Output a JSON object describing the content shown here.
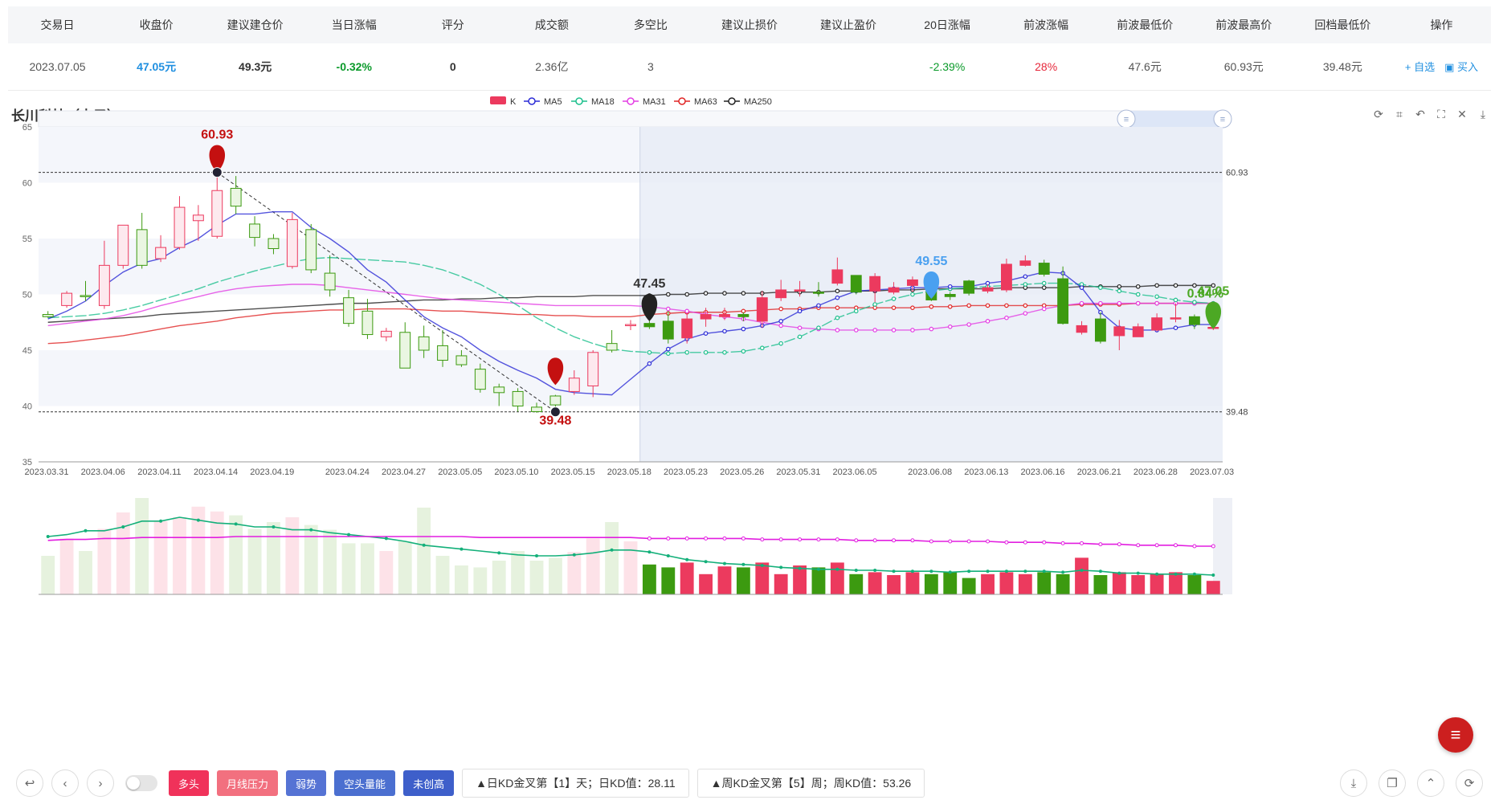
{
  "table": {
    "headers": [
      "交易日",
      "收盘价",
      "建议建仓价",
      "当日涨幅",
      "评分",
      "成交额",
      "多空比",
      "建议止损价",
      "建议止盈价",
      "20日涨幅",
      "前波涨幅",
      "前波最低价",
      "前波最高价",
      "回档最低价",
      "操作"
    ],
    "row": {
      "date": "2023.07.05",
      "close": "47.05元",
      "entry": "49.3元",
      "change": "-0.32%",
      "score": "0",
      "turnover": "2.36亿",
      "ratio": "3",
      "stop_loss": "",
      "take_profit": "",
      "chg20": "-2.39%",
      "prev_wave": "28%",
      "prev_low": "47.6元",
      "prev_high": "60.93元",
      "pullback_low": "39.48元",
      "op_watch": "+ 自选",
      "op_buy": "▣ 买入"
    }
  },
  "chart_title": "长川科技（电子）",
  "legend": [
    "K",
    "MA5",
    "MA18",
    "MA31",
    "MA63",
    "MA250"
  ],
  "colors": {
    "up": "#ec3a5e",
    "down": "#3c9a10",
    "ma5": "#2b2bd6",
    "ma18": "#1cbf8c",
    "ma31": "#e43ee4",
    "ma63": "#e02424",
    "ma250": "#222222",
    "pin_high": "#c41010",
    "pin_cur": "#4aa0f0",
    "pin_last": "#4ca824"
  },
  "chart_data": {
    "type": "candlestick",
    "ylim": [
      35,
      65
    ],
    "yticks": [
      "65",
      "60",
      "55",
      "50",
      "45",
      "40",
      "35"
    ],
    "xticks": [
      "2023.03.31",
      "2023.04.06",
      "2023.04.11",
      "2023.04.14",
      "2023.04.19",
      "2023.04.24",
      "2023.04.27",
      "2023.05.05",
      "2023.05.10",
      "2023.05.15",
      "2023.05.18",
      "2023.05.23",
      "2023.05.26",
      "2023.05.31",
      "2023.06.05",
      "2023.06.08",
      "2023.06.13",
      "2023.06.16",
      "2023.06.21",
      "2023.06.28",
      "2023.07.03"
    ],
    "candles": [
      [
        48.2,
        48.0,
        48.5,
        47.9
      ],
      [
        49.0,
        50.1,
        50.3,
        48.8
      ],
      [
        49.9,
        49.8,
        51.2,
        49.4
      ],
      [
        49.0,
        52.6,
        54.8,
        48.7
      ],
      [
        52.6,
        56.2,
        56.2,
        52.3
      ],
      [
        55.8,
        52.6,
        57.3,
        52.3
      ],
      [
        53.2,
        54.2,
        55.3,
        52.9
      ],
      [
        54.2,
        57.8,
        58.8,
        54.0
      ],
      [
        56.6,
        57.1,
        58.0,
        54.8
      ],
      [
        55.2,
        59.3,
        60.9,
        55.0
      ],
      [
        59.5,
        57.9,
        60.6,
        57.2
      ],
      [
        56.3,
        55.1,
        57.0,
        54.3
      ],
      [
        55.0,
        54.1,
        55.4,
        53.6
      ],
      [
        52.5,
        56.7,
        57.3,
        52.3
      ],
      [
        55.8,
        52.2,
        56.3,
        51.9
      ],
      [
        51.9,
        50.4,
        53.5,
        49.8
      ],
      [
        49.7,
        47.4,
        50.4,
        47.1
      ],
      [
        48.5,
        46.4,
        49.6,
        46.0
      ],
      [
        46.2,
        46.7,
        47.0,
        45.8
      ],
      [
        46.6,
        43.4,
        47.5,
        43.4
      ],
      [
        46.2,
        45.0,
        47.2,
        44.3
      ],
      [
        45.4,
        44.1,
        46.8,
        43.5
      ],
      [
        44.5,
        43.7,
        45.0,
        43.5
      ],
      [
        43.3,
        41.5,
        43.8,
        41.2
      ],
      [
        41.7,
        41.2,
        42.0,
        40.0
      ],
      [
        41.3,
        40.0,
        41.6,
        39.5
      ],
      [
        39.9,
        39.5,
        40.3,
        39.4
      ],
      [
        40.9,
        40.1,
        41.0,
        39.6
      ],
      [
        41.3,
        42.5,
        43.2,
        41.0
      ],
      [
        41.8,
        44.8,
        45.0,
        40.8
      ],
      [
        45.6,
        45.0,
        46.8,
        44.8
      ],
      [
        47.2,
        47.3,
        47.7,
        46.8
      ],
      [
        47.4,
        47.1,
        48.0,
        46.9
      ],
      [
        47.6,
        46.0,
        48.5,
        45.6
      ],
      [
        46.1,
        47.8,
        48.3,
        45.6
      ],
      [
        47.8,
        48.2,
        48.8,
        47.1
      ],
      [
        48.0,
        48.2,
        48.8,
        47.7
      ],
      [
        48.2,
        48.0,
        48.4,
        47.6
      ],
      [
        47.6,
        49.7,
        50.3,
        47.0
      ],
      [
        49.7,
        50.4,
        51.3,
        49.4
      ],
      [
        50.3,
        50.4,
        51.2,
        49.8
      ],
      [
        50.2,
        50.1,
        51.1,
        49.8
      ],
      [
        51.0,
        52.2,
        53.3,
        50.8
      ],
      [
        51.7,
        50.2,
        51.7,
        50.0
      ],
      [
        50.3,
        51.6,
        51.9,
        49.3
      ],
      [
        50.2,
        50.6,
        51.1,
        50.0
      ],
      [
        50.8,
        51.3,
        51.6,
        50.2
      ],
      [
        51.0,
        49.5,
        51.0,
        49.4
      ],
      [
        50.0,
        49.8,
        50.2,
        49.5
      ],
      [
        51.2,
        50.1,
        51.3,
        49.9
      ],
      [
        50.3,
        50.6,
        50.9,
        50.1
      ],
      [
        50.4,
        52.7,
        53.2,
        50.2
      ],
      [
        52.6,
        53.0,
        53.5,
        52.5
      ],
      [
        52.8,
        51.8,
        53.1,
        51.6
      ],
      [
        51.4,
        47.4,
        52.5,
        47.3
      ],
      [
        46.6,
        47.2,
        47.6,
        46.4
      ],
      [
        47.8,
        45.8,
        48.4,
        45.6
      ],
      [
        46.3,
        47.1,
        47.7,
        45.0
      ],
      [
        46.2,
        47.1,
        47.4,
        46.8
      ],
      [
        46.8,
        47.9,
        48.3,
        46.7
      ],
      [
        47.9,
        47.9,
        49.2,
        47.5
      ],
      [
        48.0,
        47.3,
        48.2,
        46.9
      ],
      [
        47.0,
        47.05,
        47.3,
        46.8
      ]
    ],
    "ma5": [
      47.8,
      48.5,
      49.4,
      50.8,
      52.0,
      52.8,
      53.2,
      54.2,
      55.0,
      56.2,
      57.2,
      57.2,
      57.4,
      57.4,
      56.0,
      55.0,
      53.8,
      52.2,
      51.1,
      49.5,
      48.0,
      47.0,
      46.2,
      45.0,
      44.0,
      43.2,
      42.5,
      41.5,
      41.2,
      41.1,
      41.0,
      42.4,
      43.8,
      45.1,
      46.0,
      46.5,
      46.7,
      46.9,
      47.2,
      47.6,
      48.5,
      49.0,
      49.7,
      50.3,
      50.4,
      50.5,
      50.6,
      50.6,
      50.7,
      50.7,
      51.0,
      51.2,
      51.6,
      52.0,
      51.9,
      50.6,
      48.4,
      47.0,
      46.8,
      46.8,
      47.0,
      47.3,
      47.3
    ],
    "ma18": [
      47.9,
      48.0,
      48.1,
      48.3,
      48.6,
      49.0,
      49.5,
      50.0,
      50.5,
      51.1,
      51.6,
      52.1,
      52.5,
      52.9,
      53.2,
      53.3,
      53.2,
      53.1,
      53.0,
      52.9,
      52.6,
      52.2,
      51.6,
      50.9,
      50.0,
      49.0,
      47.9,
      47.0,
      46.2,
      45.6,
      45.1,
      44.9,
      44.8,
      44.7,
      44.8,
      44.8,
      44.8,
      44.9,
      45.2,
      45.6,
      46.2,
      47.0,
      47.9,
      48.5,
      49.1,
      49.6,
      50.0,
      50.3,
      50.5,
      50.6,
      50.7,
      50.8,
      50.9,
      51.0,
      51.0,
      50.9,
      50.6,
      50.3,
      50.0,
      49.8,
      49.5,
      49.3,
      49.2
    ],
    "ma31": [
      47.2,
      47.4,
      47.6,
      47.8,
      48.1,
      48.5,
      49.0,
      49.4,
      49.8,
      50.2,
      50.5,
      50.7,
      50.8,
      50.9,
      50.9,
      50.8,
      50.6,
      50.4,
      50.2,
      50.0,
      49.8,
      49.6,
      49.5,
      49.4,
      49.3,
      49.2,
      49.1,
      49.0,
      49.0,
      49.0,
      49.0,
      49.0,
      48.9,
      48.7,
      48.5,
      48.2,
      48.0,
      47.8,
      47.5,
      47.2,
      47.0,
      46.9,
      46.8,
      46.8,
      46.8,
      46.8,
      46.8,
      46.9,
      47.1,
      47.3,
      47.6,
      47.9,
      48.3,
      48.7,
      49.0,
      49.2,
      49.2,
      49.2,
      49.2,
      49.2,
      49.2,
      49.2,
      49.2
    ],
    "ma63": [
      45.6,
      45.7,
      45.9,
      46.1,
      46.3,
      46.6,
      46.9,
      47.2,
      47.4,
      47.6,
      47.9,
      48.1,
      48.3,
      48.4,
      48.5,
      48.6,
      48.6,
      48.7,
      48.7,
      48.7,
      48.6,
      48.5,
      48.5,
      48.4,
      48.3,
      48.2,
      48.2,
      48.1,
      48.1,
      48.0,
      48.0,
      48.0,
      48.2,
      48.3,
      48.4,
      48.4,
      48.4,
      48.5,
      48.6,
      48.7,
      48.7,
      48.8,
      48.8,
      48.8,
      48.8,
      48.8,
      48.8,
      48.9,
      48.9,
      49.0,
      49.0,
      49.0,
      49.0,
      49.0,
      49.0,
      49.1,
      49.1,
      49.1,
      49.2,
      49.2,
      49.2,
      49.2,
      49.2
    ],
    "ma250": [
      47.5,
      47.6,
      47.7,
      47.8,
      47.9,
      48.0,
      48.2,
      48.3,
      48.4,
      48.5,
      48.6,
      48.7,
      48.8,
      48.9,
      49.0,
      49.1,
      49.2,
      49.2,
      49.3,
      49.4,
      49.5,
      49.5,
      49.6,
      49.6,
      49.7,
      49.7,
      49.8,
      49.8,
      49.8,
      49.9,
      49.9,
      49.9,
      49.9,
      50.0,
      50.0,
      50.1,
      50.1,
      50.1,
      50.1,
      50.2,
      50.2,
      50.2,
      50.3,
      50.3,
      50.3,
      50.4,
      50.4,
      50.5,
      50.5,
      50.5,
      50.5,
      50.6,
      50.6,
      50.6,
      50.6,
      50.7,
      50.7,
      50.7,
      50.7,
      50.8,
      50.8,
      50.8,
      50.8
    ],
    "markers": {
      "high": {
        "label": "60.93",
        "value": 60.93,
        "index": 9
      },
      "low": {
        "label": "39.48",
        "value": 39.48,
        "index": 27
      },
      "entry": {
        "label": "47.45",
        "value": 49.8,
        "index": 32
      },
      "mid": {
        "label": "49.55",
        "value": 50.8,
        "index": 47
      },
      "last_price": {
        "label": "47.05",
        "value": 49.2,
        "index": 62
      },
      "last_pct": {
        "label": "0.84%"
      }
    },
    "hlines": [
      {
        "label": "60.93",
        "value": 60.93
      },
      {
        "label": "39.48",
        "value": 39.48
      }
    ],
    "volume": [
      40,
      58,
      45,
      68,
      85,
      100,
      76,
      80,
      91,
      86,
      82,
      68,
      75,
      80,
      72,
      67,
      53,
      53,
      45,
      55,
      90,
      40,
      30,
      28,
      35,
      45,
      35,
      38,
      44,
      58,
      75,
      55,
      31,
      28,
      33,
      21,
      29,
      28,
      33,
      21,
      30,
      28,
      33,
      21,
      23,
      20,
      23,
      21,
      23,
      17,
      21,
      23,
      21,
      23,
      21,
      38,
      20,
      23,
      20,
      21,
      23,
      20,
      14
    ],
    "vol_line1": [
      60,
      62,
      66,
      66,
      70,
      76,
      76,
      80,
      77,
      74,
      73,
      70,
      70,
      67,
      67,
      64,
      62,
      60,
      58,
      55,
      51,
      49,
      47,
      45,
      43,
      41,
      40,
      40,
      41,
      43,
      46,
      46,
      44,
      40,
      36,
      34,
      32,
      31,
      30,
      28,
      27,
      26,
      26,
      25,
      25,
      24,
      24,
      24,
      23,
      24,
      24,
      24,
      24,
      24,
      23,
      25,
      24,
      22,
      22,
      21,
      21,
      21,
      20
    ],
    "vol_line2": [
      56,
      57,
      57,
      58,
      58,
      59,
      59,
      59,
      59,
      59,
      60,
      60,
      60,
      60,
      60,
      60,
      60,
      60,
      60,
      60,
      60,
      60,
      60,
      59,
      59,
      59,
      59,
      59,
      59,
      59,
      59,
      59,
      58,
      58,
      58,
      58,
      58,
      58,
      57,
      57,
      57,
      57,
      57,
      56,
      56,
      56,
      56,
      55,
      55,
      55,
      55,
      54,
      54,
      54,
      53,
      53,
      52,
      52,
      51,
      51,
      51,
      50,
      50
    ],
    "projection_start_index": 32
  },
  "bottom": {
    "tag_bull": "多头",
    "tag_monthly": "月线压力",
    "tag_weak": "弱势",
    "tag_empty_head": "空头量能",
    "tag_new_high": "未创高",
    "signal_daily": "▲日KD金叉第【1】天；日KD值：28.11",
    "signal_weekly": "▲周KD金叉第【5】周；周KD值：53.26"
  },
  "icons": {
    "back": "↩",
    "prev": "‹",
    "next": "›",
    "download": "⤓",
    "copy": "❐",
    "up": "⌃",
    "refresh": "⟳",
    "menu": "≡"
  }
}
